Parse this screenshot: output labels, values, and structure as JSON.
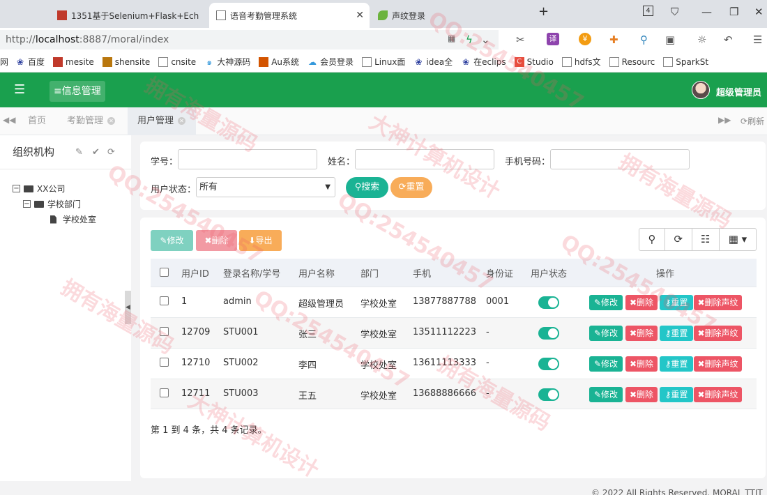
{
  "browser": {
    "tabs": [
      {
        "title": "1351基于Selenium+Flask+Ech"
      },
      {
        "title": "语音考勤管理系统"
      },
      {
        "title": "声纹登录"
      }
    ],
    "tab_count": "4",
    "url_prefix": "http://",
    "url_host": "localhost",
    "url_rest": ":8887/moral/index",
    "bookmarks": [
      "网",
      "百度",
      "mesite",
      "shensite",
      "cnsite",
      "大神源码",
      "Au系统",
      "会员登录",
      "Linux面",
      "idea全",
      "在eclips",
      "Studio",
      "hdfs文",
      "Resourc",
      "SparkSt"
    ]
  },
  "header": {
    "menu_label": "≡信息管理",
    "user_name": "超级管理员"
  },
  "page_tabs": {
    "items": [
      {
        "label": "首页"
      },
      {
        "label": "考勤管理"
      },
      {
        "label": "用户管理"
      }
    ],
    "refresh_label": "刷新"
  },
  "sidebar": {
    "title": "组织机构",
    "tree": [
      {
        "label": "XX公司"
      },
      {
        "label": "学校部门"
      },
      {
        "label": "学校处室"
      }
    ]
  },
  "search": {
    "student_no_label": "学号：",
    "name_label": "姓名：",
    "phone_label": "手机号码：",
    "status_label": "用户状态：",
    "status_value": "所有",
    "search_button": "搜索",
    "reset_button": "重置"
  },
  "toolbar": {
    "edit_label": "修改",
    "delete_label": "删除",
    "export_label": "导出"
  },
  "table": {
    "columns": [
      "用户ID",
      "登录名称/学号",
      "用户名称",
      "部门",
      "手机",
      "身份证",
      "用户状态",
      "操作"
    ],
    "rows": [
      {
        "id": "1",
        "login": "admin",
        "name": "超级管理员",
        "dept": "学校处室",
        "phone": "13877887788",
        "idcard": "0001"
      },
      {
        "id": "12709",
        "login": "STU001",
        "name": "张三",
        "dept": "学校处室",
        "phone": "13511112223",
        "idcard": "-"
      },
      {
        "id": "12710",
        "login": "STU002",
        "name": "李四",
        "dept": "学校处室",
        "phone": "13611113333",
        "idcard": "-"
      },
      {
        "id": "12711",
        "login": "STU003",
        "name": "王五",
        "dept": "学校处室",
        "phone": "13688886666",
        "idcard": "-"
      }
    ],
    "actions": {
      "edit": "修改",
      "delete": "删除",
      "reset": "重置",
      "delete_voiceprint": "删除声纹"
    }
  },
  "pager_text": "第 1 到 4 条，共 4 条记录。",
  "footer_text": "© 2022 All Rights Reserved. MORAL TTIT",
  "watermarks": {
    "qq": "QQ:254540457",
    "text1": "拥有海量源码",
    "text2": "大神计算机设计"
  },
  "colors": {
    "header_green": "#1aa04e",
    "primary": "#1ab394",
    "danger": "#ed5565",
    "info": "#23c6c8",
    "warning": "#f8ac59"
  }
}
